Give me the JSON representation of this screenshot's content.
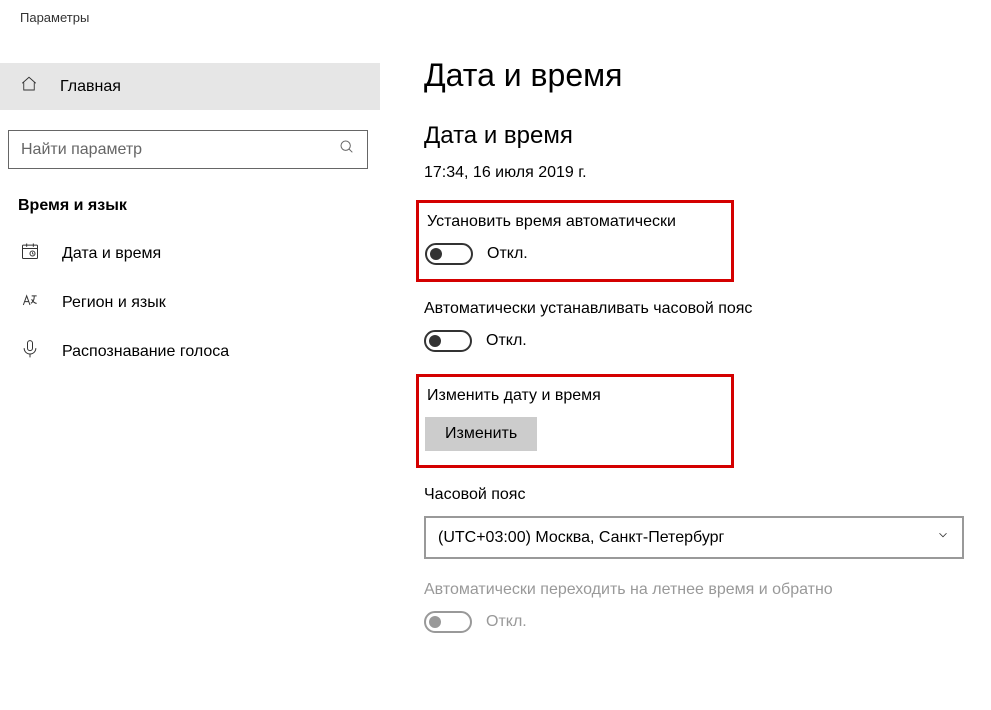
{
  "window_title": "Параметры",
  "sidebar": {
    "home": "Главная",
    "search_placeholder": "Найти параметр",
    "section": "Время и язык",
    "items": [
      {
        "label": "Дата и время",
        "icon": "calendar-icon"
      },
      {
        "label": "Регион и язык",
        "icon": "language-icon"
      },
      {
        "label": "Распознавание голоса",
        "icon": "microphone-icon"
      }
    ]
  },
  "main": {
    "title": "Дата и время",
    "subtitle": "Дата и время",
    "current_datetime": "17:34, 16 июля 2019 г.",
    "auto_time": {
      "label": "Установить время автоматически",
      "status": "Откл."
    },
    "auto_tz": {
      "label": "Автоматически устанавливать часовой пояс",
      "status": "Откл."
    },
    "change_dt": {
      "label": "Изменить дату и время",
      "button": "Изменить"
    },
    "timezone": {
      "label": "Часовой пояс",
      "value": "(UTC+03:00) Москва, Санкт-Петербург"
    },
    "dst": {
      "label": "Автоматически переходить на летнее время и обратно",
      "status": "Откл."
    }
  }
}
